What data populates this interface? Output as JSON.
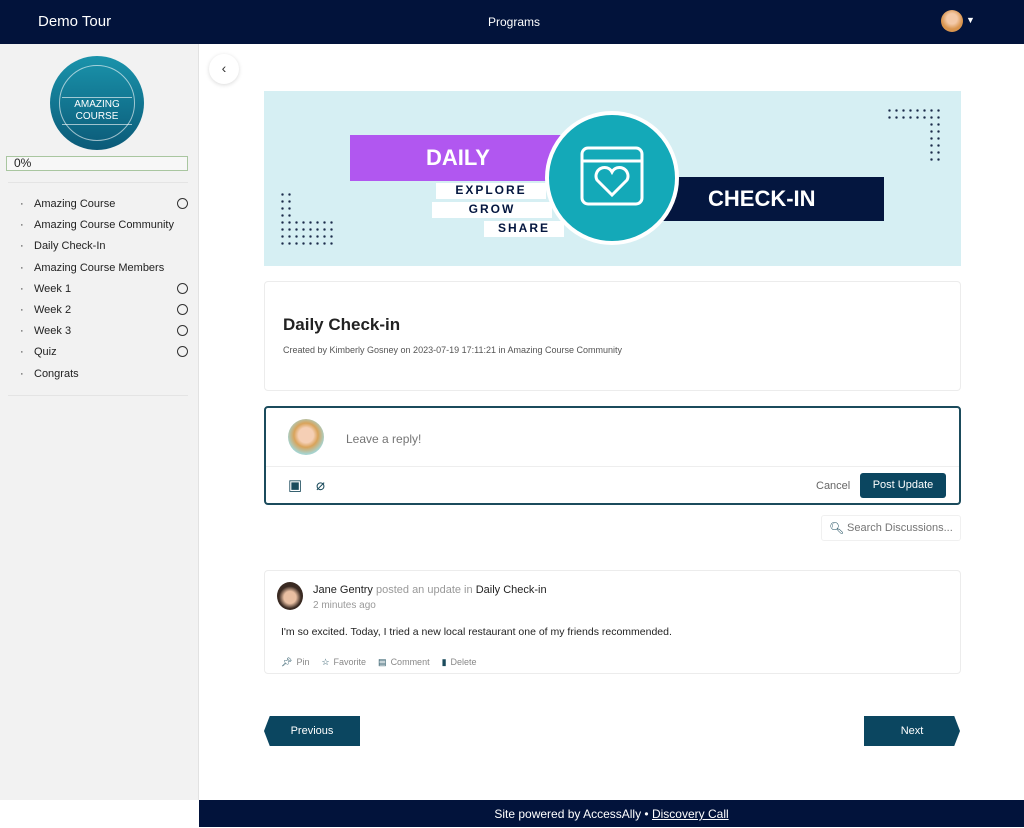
{
  "header": {
    "brand": "Demo Tour",
    "nav": "Programs"
  },
  "sidebar": {
    "badge": "AMAZING COURSE",
    "progress": "0%",
    "progress_value": 0,
    "items": [
      {
        "label": "Amazing Course",
        "circle": true
      },
      {
        "label": "Amazing Course Community",
        "circle": false
      },
      {
        "label": "Daily Check-In",
        "circle": false
      },
      {
        "label": "Amazing Course Members",
        "circle": false
      },
      {
        "label": "Week 1",
        "circle": true
      },
      {
        "label": "Week 2",
        "circle": true
      },
      {
        "label": "Week 3",
        "circle": true
      },
      {
        "label": "Quiz",
        "circle": true
      },
      {
        "label": "Congrats",
        "circle": false
      }
    ]
  },
  "banner": {
    "daily": "DAILY",
    "checkin": "CHECK-IN",
    "words": [
      "EXPLORE",
      "GROW",
      "SHARE"
    ],
    "colors": {
      "purple": "#b157f0",
      "navy": "#04163f",
      "teal": "#14a9b8"
    }
  },
  "post": {
    "title": "Daily Check-in",
    "meta": "Created by Kimberly Gosney on 2023-07-19 17:11:21 in Amazing Course Community"
  },
  "reply": {
    "placeholder": "Leave a reply!",
    "cancel": "Cancel",
    "submit": "Post Update"
  },
  "search": {
    "placeholder": "Search Discussions..."
  },
  "update": {
    "author": "Jane Gentry",
    "action": "posted an update in",
    "target": "Daily Check-in",
    "time": "2 minutes ago",
    "body": "I'm so excited. Today, I tried a new local restaurant one of my friends recommended.",
    "actions": [
      "Pin",
      "Favorite",
      "Comment",
      "Delete"
    ]
  },
  "pager": {
    "prev": "Previous",
    "next": "Next"
  },
  "footer": {
    "text": "Site powered by AccessAlly •",
    "link": "Discovery Call"
  }
}
